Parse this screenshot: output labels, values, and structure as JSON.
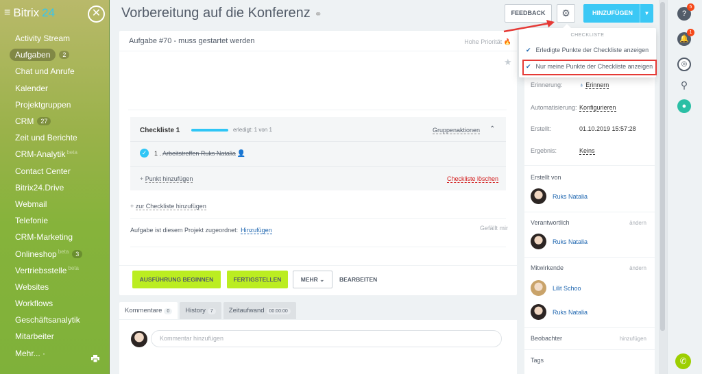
{
  "sidebar": {
    "brand": "Bitrix",
    "brand_num": "24",
    "items": [
      {
        "label": "Activity Stream",
        "count": "",
        "beta": ""
      },
      {
        "label": "Aufgaben",
        "count": "2",
        "beta": ""
      },
      {
        "label": "Chat und Anrufe",
        "count": "",
        "beta": ""
      },
      {
        "label": "Kalender",
        "count": "",
        "beta": ""
      },
      {
        "label": "Projektgruppen",
        "count": "",
        "beta": ""
      },
      {
        "label": "CRM",
        "count": "27",
        "beta": ""
      },
      {
        "label": "Zeit und Berichte",
        "count": "",
        "beta": ""
      },
      {
        "label": "CRM-Analytik",
        "count": "",
        "beta": "beta"
      },
      {
        "label": "Contact Center",
        "count": "",
        "beta": ""
      },
      {
        "label": "Bitrix24.Drive",
        "count": "",
        "beta": ""
      },
      {
        "label": "Webmail",
        "count": "",
        "beta": ""
      },
      {
        "label": "Telefonie",
        "count": "",
        "beta": ""
      },
      {
        "label": "CRM-Marketing",
        "count": "",
        "beta": ""
      },
      {
        "label": "Onlineshop",
        "count": "3",
        "beta": "beta"
      },
      {
        "label": "Vertriebsstelle",
        "count": "",
        "beta": "beta"
      },
      {
        "label": "Websites",
        "count": "",
        "beta": ""
      },
      {
        "label": "Workflows",
        "count": "",
        "beta": ""
      },
      {
        "label": "Geschäftsanalytik",
        "count": "",
        "beta": ""
      },
      {
        "label": "Mitarbeiter",
        "count": "",
        "beta": ""
      },
      {
        "label": "Mehr... ·",
        "count": "",
        "beta": ""
      }
    ]
  },
  "header": {
    "title": "Vorbereitung auf die Konferenz",
    "feedback": "FEEDBACK",
    "add": "HINZUFÜGEN"
  },
  "task": {
    "subtitle": "Aufgabe #70 - muss gestartet werden",
    "priority": "Hohe Priorität",
    "checklist": {
      "title": "Checkliste 1",
      "done": "erledigt: 1 von 1",
      "group_actions": "Gruppenaktionen",
      "item_num": "1 .",
      "item_text": "Arbeitstreffen Ruks Natalia",
      "add_point_prefix": "+ ",
      "add_point": "Punkt hinzufügen",
      "delete": "Checkliste löschen"
    },
    "add_to_checklist_prefix": "+ ",
    "add_to_checklist": "zur Checkliste hinzufügen",
    "project_text": "Aufgabe ist diesem Projekt zugeordnet:",
    "project_add": "Hinzufügen",
    "like": "Gefällt mir",
    "buttons": {
      "start": "AUSFÜHRUNG BEGINNEN",
      "finish": "FERTIGSTELLEN",
      "more": "MEHR",
      "edit": "BEARBEITEN"
    }
  },
  "tabs": [
    {
      "label": "Kommentare",
      "count": "0"
    },
    {
      "label": "History",
      "count": "7"
    },
    {
      "label": "Zeitaufwand",
      "count": "00:00:00"
    }
  ],
  "comment_placeholder": "Kommentar hinzufügen",
  "dropdown": {
    "header": "CHECKLISTE",
    "opt1": "Erledigte Punkte der Checkliste anzeigen",
    "opt2": "Nur meine Punkte der Checkliste anzeigen"
  },
  "details": {
    "reminder_label": "Erinnerung:",
    "reminder_value": "Erinnern",
    "automation_label": "Automatisierung:",
    "automation_value": "Konfigurieren",
    "created_label": "Erstellt:",
    "created_value": "01.10.2019 15:57:28",
    "result_label": "Ergebnis:",
    "result_value": "Keins",
    "creator_section": "Erstellt von",
    "creator": "Ruks Natalia",
    "responsible_section": "Verantwortlich",
    "responsible_action": "ändern",
    "responsible": "Ruks Natalia",
    "participants_section": "Mitwirkende",
    "participants_action": "ändern",
    "participant1": "Lilit Schoo",
    "participant2": "Ruks Natalia",
    "observers_section": "Beobachter",
    "observers_action": "hinzufügen",
    "tags_section": "Tags"
  },
  "right_bar": {
    "help_badge": "5",
    "notif_badge": "1"
  },
  "colors": {
    "accent": "#3bc8f5",
    "green_button": "#bbed21",
    "highlight": "#e53935"
  }
}
